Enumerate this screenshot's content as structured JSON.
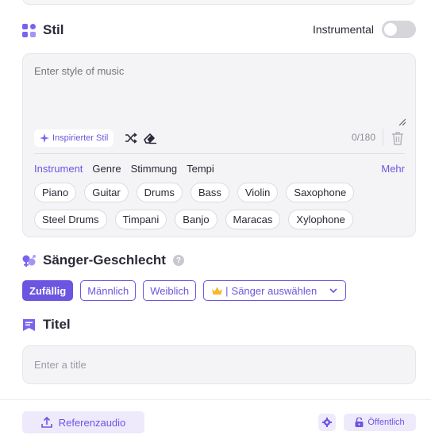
{
  "style_section": {
    "title": "Stil",
    "icon": "grid-shapes-icon",
    "instrumental_label": "Instrumental",
    "instrumental_on": false,
    "textarea_placeholder": "Enter style of music",
    "inspire_label": "Inspirierter Stil",
    "char_count": "0/180",
    "tabs": [
      "Instrument",
      "Genre",
      "Stimmung",
      "Tempi"
    ],
    "active_tab": "Instrument",
    "more_label": "Mehr",
    "chips_row1": [
      "Piano",
      "Guitar",
      "Drums",
      "Bass",
      "Violin",
      "Saxophone"
    ],
    "chips_row2": [
      "Steel Drums",
      "Timpani",
      "Banjo",
      "Maracas",
      "Xylophone"
    ]
  },
  "singer_section": {
    "title": "Sänger-Geschlecht",
    "help": "?",
    "options": [
      "Zufällig",
      "Männlich",
      "Weiblich"
    ],
    "selected": "Zufällig",
    "choose_singer_label": "Sänger auswählen"
  },
  "title_section": {
    "title": "Titel",
    "placeholder": "Enter a title"
  },
  "bottom_bar": {
    "reference_audio_label": "Referenzaudio",
    "public_label": "Öffentlich"
  },
  "colors": {
    "accent": "#6c55e0",
    "card_bg": "#f4f4f6",
    "toggle_off": "#d5d5da"
  }
}
